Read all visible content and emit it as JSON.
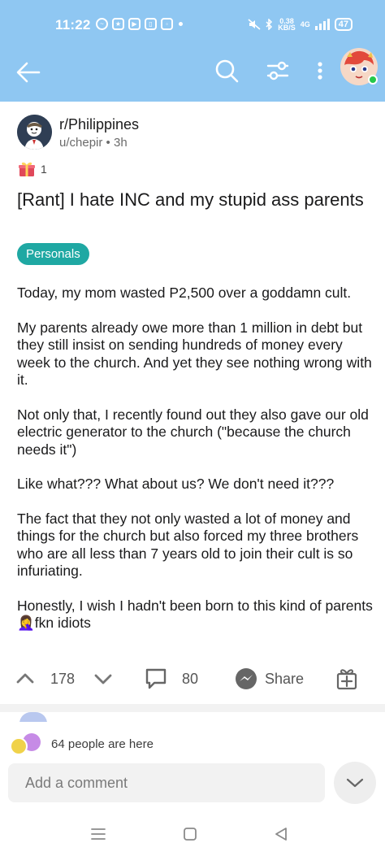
{
  "status_bar": {
    "time": "11:22",
    "speed_value": "0.38",
    "speed_unit": "KB/S",
    "network": "4G",
    "battery": "47"
  },
  "app_bar": {
    "back_icon": "arrow-left-icon",
    "search_icon": "search-icon",
    "filter_icon": "sliders-icon",
    "more_icon": "more-vertical-icon",
    "avatar_status": "online"
  },
  "post": {
    "subreddit": "r/Philippines",
    "author": "u/chepir",
    "separator": "•",
    "age": "3h",
    "award_count": "1",
    "title": "[Rant] I hate INC and my stupid ass parents",
    "flair": "Personals",
    "paragraphs": [
      "Today, my mom wasted P2,500 over a goddamn cult.",
      "My parents already owe more than 1 million in debt but they still insist on sending hundreds of money every week to the church. And yet they see nothing wrong with it.",
      "Not only that, I recently found out they also gave our old electric generator to the church (\"because the church needs it\")",
      "Like what??? What about us? We don't need it???",
      "The fact that they not only wasted a lot of money and things for the church but also forced my three brothers who are all less than 7 years old to join their cult is so infuriating.",
      "Honestly, I wish I hadn't been born to this kind of parents 🤦‍♀️fkn idiots"
    ]
  },
  "actions": {
    "score": "178",
    "comments": "80",
    "share_label": "Share"
  },
  "presence": {
    "text": "64 people are here"
  },
  "comment_box": {
    "placeholder": "Add a comment"
  },
  "colors": {
    "header": "#8fc7f2",
    "flair": "#1fa8a3",
    "online": "#25c84a"
  }
}
